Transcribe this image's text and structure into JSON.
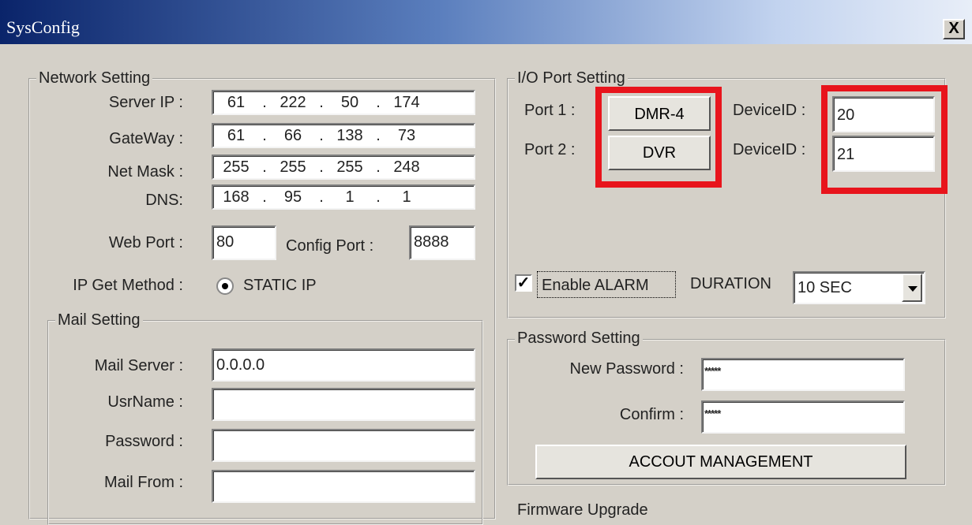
{
  "window": {
    "title": "SysConfig",
    "close_glyph": "X"
  },
  "network": {
    "legend": "Network Setting",
    "server_ip": {
      "label": "Server IP :",
      "octets": [
        "61",
        "222",
        "50",
        "174"
      ]
    },
    "gateway": {
      "label": "GateWay :",
      "octets": [
        "61",
        "66",
        "138",
        "73"
      ]
    },
    "net_mask": {
      "label": "Net Mask :",
      "octets": [
        "255",
        "255",
        "255",
        "248"
      ]
    },
    "dns": {
      "label": "DNS:",
      "octets": [
        "168",
        "95",
        "1",
        "1"
      ]
    },
    "web_port": {
      "label": "Web Port :",
      "value": "80"
    },
    "config_port": {
      "label": "Config Port :",
      "value": "8888"
    },
    "ip_method": {
      "label": "IP Get Method :",
      "option": "STATIC IP",
      "selected": true
    }
  },
  "mail": {
    "legend": "Mail Setting",
    "server": {
      "label": "Mail Server :",
      "value": "0.0.0.0"
    },
    "username": {
      "label": "UsrName :",
      "value": ""
    },
    "password": {
      "label": "Password :",
      "value": ""
    },
    "from": {
      "label": "Mail From :",
      "value": ""
    }
  },
  "io": {
    "legend": "I/O Port Setting",
    "port1": {
      "label": "Port 1 :",
      "button": "DMR-4",
      "device_label": "DeviceID :",
      "device_id": "20"
    },
    "port2": {
      "label": "Port 2 :",
      "button": "DVR",
      "device_label": "DeviceID :",
      "device_id": "21"
    },
    "alarm": {
      "label": "Enable ALARM",
      "checked": true,
      "check_glyph": "✓"
    },
    "duration": {
      "label": "DURATION",
      "value": "10 SEC"
    },
    "highlight_color": "#e8141c"
  },
  "password": {
    "legend": "Password Setting",
    "new": {
      "label": "New Password :",
      "value": "*****"
    },
    "confirm": {
      "label": "Confirm :",
      "value": "*****"
    },
    "account_button": "ACCOUT MANAGEMENT"
  },
  "firmware": {
    "legend": "Firmware Upgrade"
  }
}
